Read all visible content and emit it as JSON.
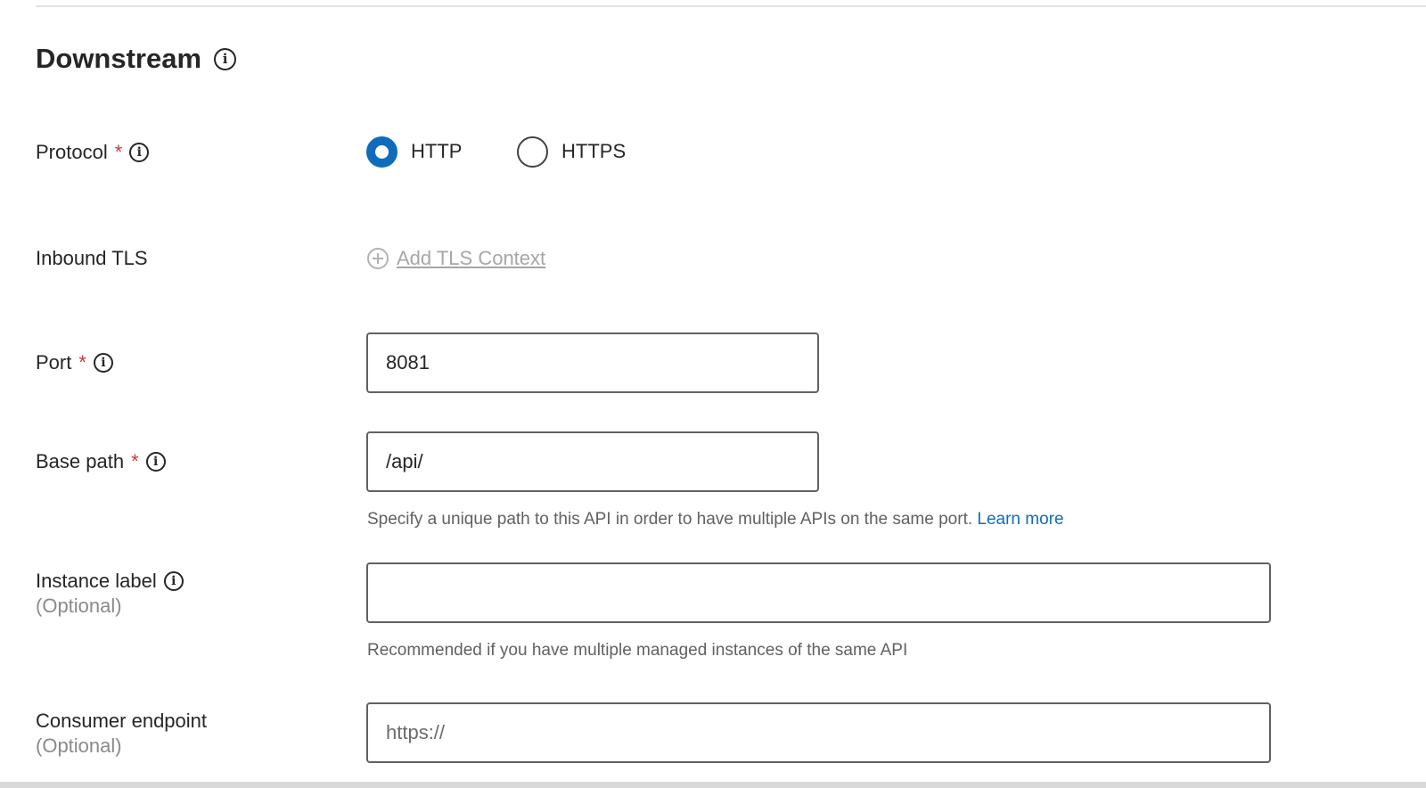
{
  "section": {
    "title": "Downstream",
    "info_icon": "info-icon"
  },
  "protocol": {
    "label": "Protocol",
    "required_mark": "*",
    "options": [
      {
        "label": "HTTP",
        "checked": true
      },
      {
        "label": "HTTPS",
        "checked": false
      }
    ],
    "selected": "HTTP"
  },
  "inbound_tls": {
    "label": "Inbound TLS",
    "add_label": "Add TLS Context",
    "add_icon": "plus-circle-icon"
  },
  "port": {
    "label": "Port",
    "required_mark": "*",
    "value": "8081"
  },
  "base_path": {
    "label": "Base path",
    "required_mark": "*",
    "value": "/api/",
    "hint": "Specify a unique path to this API in order to have multiple APIs on the same port.",
    "hint_link": "Learn more"
  },
  "instance_label": {
    "label": "Instance label",
    "optional": "(Optional)",
    "value": "",
    "hint": "Recommended if you have multiple managed instances of the same API"
  },
  "consumer_endpoint": {
    "label": "Consumer endpoint",
    "optional": "(Optional)",
    "value": "",
    "placeholder": "https://"
  },
  "colors": {
    "accent": "#0f6cbd",
    "required": "#d13438",
    "text": "#262626",
    "muted": "#8a8a8a",
    "disabled_link": "#a6a6a6"
  }
}
